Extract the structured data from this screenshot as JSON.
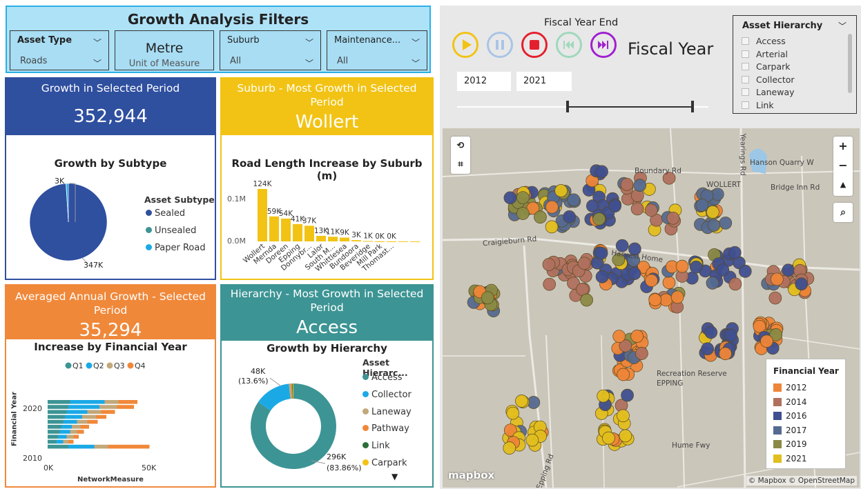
{
  "filters": {
    "title": "Growth Analysis Filters",
    "asset_type": {
      "label": "Asset Type",
      "value": "Roads"
    },
    "unit": {
      "value": "Metre",
      "caption": "Unit of Measure"
    },
    "suburb": {
      "label": "Suburb",
      "value": "All"
    },
    "maintenance": {
      "label": "Maintenance...",
      "value": "All"
    }
  },
  "growth": {
    "title": "Growth in Selected Period",
    "value": "352,944",
    "chart_title": "Growth by Subtype",
    "legend_title": "Asset Subtype",
    "legend": [
      "Sealed",
      "Unsealed",
      "Paper Road"
    ],
    "label_small": "3K",
    "label_big": "347K"
  },
  "suburb_card": {
    "title": "Suburb - Most Growth in Selected Period",
    "value": "Wollert",
    "chart_title": "Road Length Increase by Suburb (m)"
  },
  "avg": {
    "title": "Averaged Annual Growth - Selected Period",
    "value": "35,294",
    "chart_title": "Increase by Financial Year",
    "legend": [
      "Q1",
      "Q2",
      "Q3",
      "Q4"
    ],
    "ylabel": "Financial Year",
    "xlabel": "NetworkMeasure",
    "yticks": [
      "2020",
      "2010"
    ],
    "xticks": [
      "0K",
      "50K"
    ]
  },
  "hier": {
    "title": "Hierarchy - Most Growth in Selected Period",
    "value": "Access",
    "chart_title": "Growth by Hierarchy",
    "legend_title": "Asset Hierarc...",
    "legend": [
      "Access",
      "Collector",
      "Laneway",
      "Pathway",
      "Link",
      "Carpark"
    ],
    "label_small": "48K",
    "label_small_pct": "(13.6%)",
    "label_big": "296K",
    "label_big_pct": "(83.86%)"
  },
  "player": {
    "title": "Fiscal Year End",
    "field": "Fiscal Year",
    "start": "2012",
    "end": "2021"
  },
  "hierarchy_slicer": {
    "title": "Asset Hierarchy",
    "items": [
      "Access",
      "Arterial",
      "Carpark",
      "Collector",
      "Laneway",
      "Link"
    ]
  },
  "map": {
    "labels": [
      "Boundary Rd",
      "Hanson Quarry W",
      "WOLLERT",
      "Bridge Inn Rd",
      "Craigieburn Rd",
      "Harvest Home",
      "Recreation Reserve",
      "EPPING",
      "Hume Fwy",
      "Epping Rd",
      "Yearings Rd"
    ],
    "legend_title": "Financial Year",
    "legend": [
      "2012",
      "2014",
      "2016",
      "2017",
      "2019",
      "2021"
    ],
    "attribution": "© Mapbox © OpenStreetMap",
    "logo": "mapbox"
  },
  "colors": {
    "blue": "#2f4f9f",
    "yellow": "#f2c314",
    "orange": "#f0883a",
    "teal": "#3d9494",
    "light_blue": "#aee2f7"
  },
  "chart_data": [
    {
      "type": "pie",
      "title": "Growth by Subtype",
      "categories": [
        "Sealed",
        "Unsealed",
        "Paper Road"
      ],
      "values": [
        347,
        0.5,
        3
      ],
      "colors": [
        "#2f4f9f",
        "#3d9494",
        "#1ba9e6"
      ]
    },
    {
      "type": "bar",
      "title": "Road Length Increase by Suburb (m)",
      "categories": [
        "Wollert",
        "Mernda",
        "Doreen",
        "Epping",
        "Donnybr...",
        "Lalor",
        "South M...",
        "Whittlesea",
        "Bundoora",
        "Beveridge",
        "Mill Park",
        "Thomast...",
        "",
        ""
      ],
      "values": [
        124,
        59,
        54,
        41,
        37,
        13,
        11,
        9,
        3,
        1,
        0,
        0,
        0.3,
        0.2
      ],
      "data_labels": [
        "124K",
        "59K",
        "54K",
        "41K",
        "37K",
        "13K",
        "11K",
        "9K",
        "3K",
        "1K",
        "0K",
        "0K",
        "",
        ""
      ],
      "yticks": [
        "0.0M",
        "0.1M"
      ],
      "ylim": [
        0,
        150
      ]
    },
    {
      "type": "bar",
      "orientation": "horizontal",
      "stacked": true,
      "title": "Increase by Financial Year",
      "series": [
        {
          "name": "Q1",
          "values": [
            13,
            12,
            11,
            10,
            9,
            8,
            7,
            6,
            5,
            12
          ]
        },
        {
          "name": "Q2",
          "values": [
            20,
            18,
            12,
            10,
            8,
            6,
            6,
            5,
            4,
            15
          ]
        },
        {
          "name": "Q3",
          "values": [
            8,
            10,
            8,
            8,
            6,
            5,
            4,
            4,
            3,
            8
          ]
        },
        {
          "name": "Q4",
          "values": [
            11,
            10,
            8,
            6,
            6,
            5,
            4,
            3,
            3,
            24
          ]
        }
      ],
      "xlim": [
        0,
        60
      ]
    },
    {
      "type": "pie",
      "title": "Growth by Hierarchy",
      "categories": [
        "Access",
        "Collector",
        "Laneway",
        "Pathway",
        "Link",
        "Carpark"
      ],
      "values": [
        296,
        48,
        2.5,
        1.5,
        1,
        1
      ],
      "colors": [
        "#3d9494",
        "#1ba9e6",
        "#c2a87a",
        "#f0883a",
        "#2c6e3a",
        "#f2c314"
      ]
    }
  ]
}
